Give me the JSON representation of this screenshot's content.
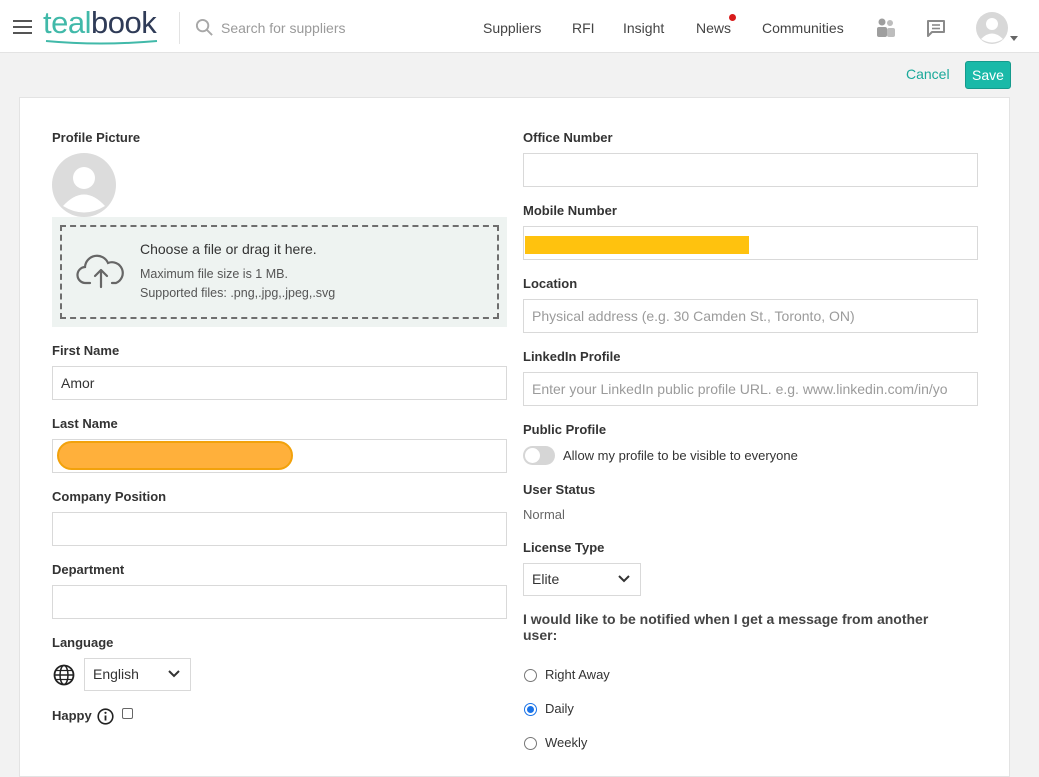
{
  "header": {
    "logo_teal": "teal",
    "logo_book": "book",
    "search_placeholder": "Search for suppliers",
    "nav": [
      "Suppliers",
      "RFI",
      "Insight",
      "News",
      "Communities"
    ],
    "news_has_notification": true
  },
  "actions": {
    "cancel": "Cancel",
    "save": "Save"
  },
  "form": {
    "profile_picture_label": "Profile Picture",
    "upload": {
      "title": "Choose a file or drag it here.",
      "max_size": "Maximum file size is 1 MB.",
      "supported": "Supported files: .png,.jpg,.jpeg,.svg"
    },
    "first_name": {
      "label": "First Name",
      "value": "Amor"
    },
    "last_name": {
      "label": "Last Name",
      "value": ""
    },
    "company_position": {
      "label": "Company Position",
      "value": ""
    },
    "department": {
      "label": "Department",
      "value": ""
    },
    "language": {
      "label": "Language",
      "value": "English"
    },
    "happy": {
      "label": "Happy",
      "checked": false
    },
    "office_number": {
      "label": "Office Number",
      "value": ""
    },
    "mobile_number": {
      "label": "Mobile Number",
      "value": ""
    },
    "location": {
      "label": "Location",
      "placeholder": "Physical address (e.g. 30 Camden St., Toronto, ON)"
    },
    "linkedin": {
      "label": "LinkedIn Profile",
      "placeholder": "Enter your LinkedIn public profile URL. e.g. www.linkedin.com/in/yo"
    },
    "public_profile": {
      "label": "Public Profile",
      "toggle_text": "Allow my profile to be visible to everyone",
      "enabled": false
    },
    "user_status": {
      "label": "User Status",
      "value": "Normal"
    },
    "license_type": {
      "label": "License Type",
      "value": "Elite"
    },
    "notify": {
      "question": "I would like to be notified when I get a message from another user:",
      "options": [
        "Right Away",
        "Daily",
        "Weekly"
      ],
      "selected": "Daily"
    }
  },
  "colors": {
    "brand_teal": "#1ab9a8",
    "logo_navy": "#2f3b57",
    "notification_red": "#d81b1b",
    "radio_blue": "#1a73e8"
  },
  "icons": [
    "menu-icon",
    "search-icon",
    "people-icon",
    "chat-icon",
    "user-avatar-icon",
    "upload-cloud-icon",
    "globe-icon",
    "info-icon",
    "chevron-down-icon"
  ]
}
